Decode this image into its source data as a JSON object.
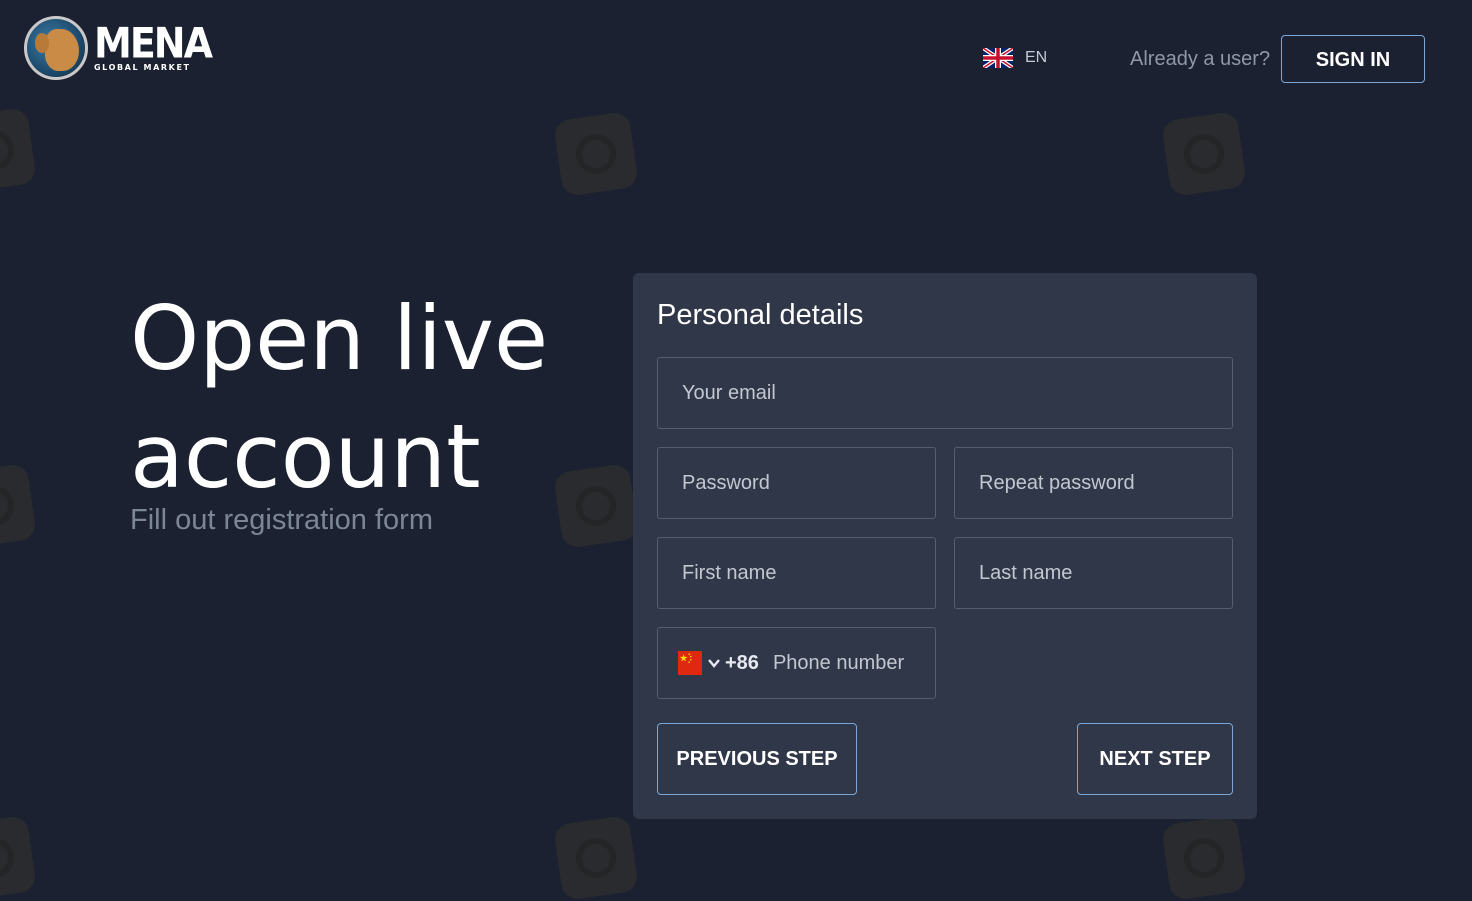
{
  "header": {
    "brand_main": "MENA",
    "brand_sub": "GLOBAL MARKET",
    "language_code": "EN",
    "already_user_text": "Already a user?",
    "sign_in_label": "SIGN IN"
  },
  "hero": {
    "title": "Open live account",
    "subtitle": "Fill out registration form"
  },
  "form": {
    "title": "Personal details",
    "email_placeholder": "Your email",
    "password_placeholder": "Password",
    "repeat_password_placeholder": "Repeat password",
    "first_name_placeholder": "First name",
    "last_name_placeholder": "Last name",
    "phone": {
      "dial_code": "+86",
      "placeholder": "Phone number"
    },
    "previous_label": "PREVIOUS STEP",
    "next_label": "NEXT STEP"
  },
  "icons": {
    "language_flag": "uk-flag-icon",
    "country_flag": "china-flag-icon",
    "country_dropdown": "chevron-down-icon",
    "logo": "globe-logo-icon"
  },
  "colors": {
    "background": "#1b2130",
    "card": "#303748",
    "button_border": "#7aa7d9",
    "muted_text": "#7d8697"
  }
}
